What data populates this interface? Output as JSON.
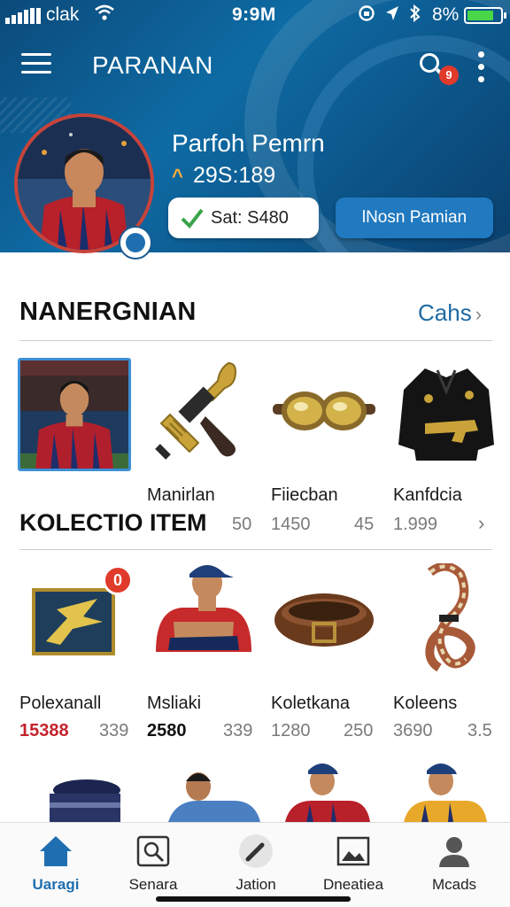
{
  "status_bar": {
    "carrier": "clak",
    "time": "9:9M",
    "battery_text": "8%",
    "battery_level": 0.8,
    "icons": [
      "signal-icon",
      "wifi-icon",
      "lock-rotation-icon",
      "location-icon",
      "bluetooth-icon",
      "battery-icon"
    ]
  },
  "header": {
    "title": "PARANAN",
    "search_badge": "9",
    "profile_name": "Parfoh Pemrn",
    "score_icon": "^",
    "score": "29S:189",
    "sat_label": "Sat: S480",
    "primary_button": "lNosn Pamian"
  },
  "section": {
    "title": "NANERGNIAN",
    "link": "Cahs",
    "link_chevron": "›"
  },
  "row1": {
    "names": [
      "Manirlan",
      "Fiiecban",
      "Kanfdcia"
    ],
    "heading": "KOLECTIO ITEM",
    "prices": [
      "50",
      "1450",
      "45",
      "1.999"
    ],
    "chevron": "›"
  },
  "row2": {
    "badge": "0",
    "names": [
      "Polexanall",
      "Msliaki",
      "Koletkana",
      "Koleens"
    ],
    "prices": [
      "15388",
      "339",
      "2580",
      "339",
      "1280",
      "250",
      "3690",
      "3.5"
    ]
  },
  "bottom_nav": [
    {
      "label": "Uaragi",
      "icon": "home-icon",
      "active": true
    },
    {
      "label": "Senara",
      "icon": "search-image-icon",
      "active": false
    },
    {
      "label": "Jation",
      "icon": "pen-icon",
      "active": false
    },
    {
      "label": "Dneatiea",
      "icon": "image-icon",
      "active": false
    },
    {
      "label": "Mcads",
      "icon": "profile-icon",
      "active": false
    }
  ],
  "colors": {
    "header_blue": "#0e6ba4",
    "accent_blue": "#2179bf",
    "link_blue": "#1e6aa3",
    "price_red": "#c4232c",
    "badge_red": "#e03a2a"
  }
}
